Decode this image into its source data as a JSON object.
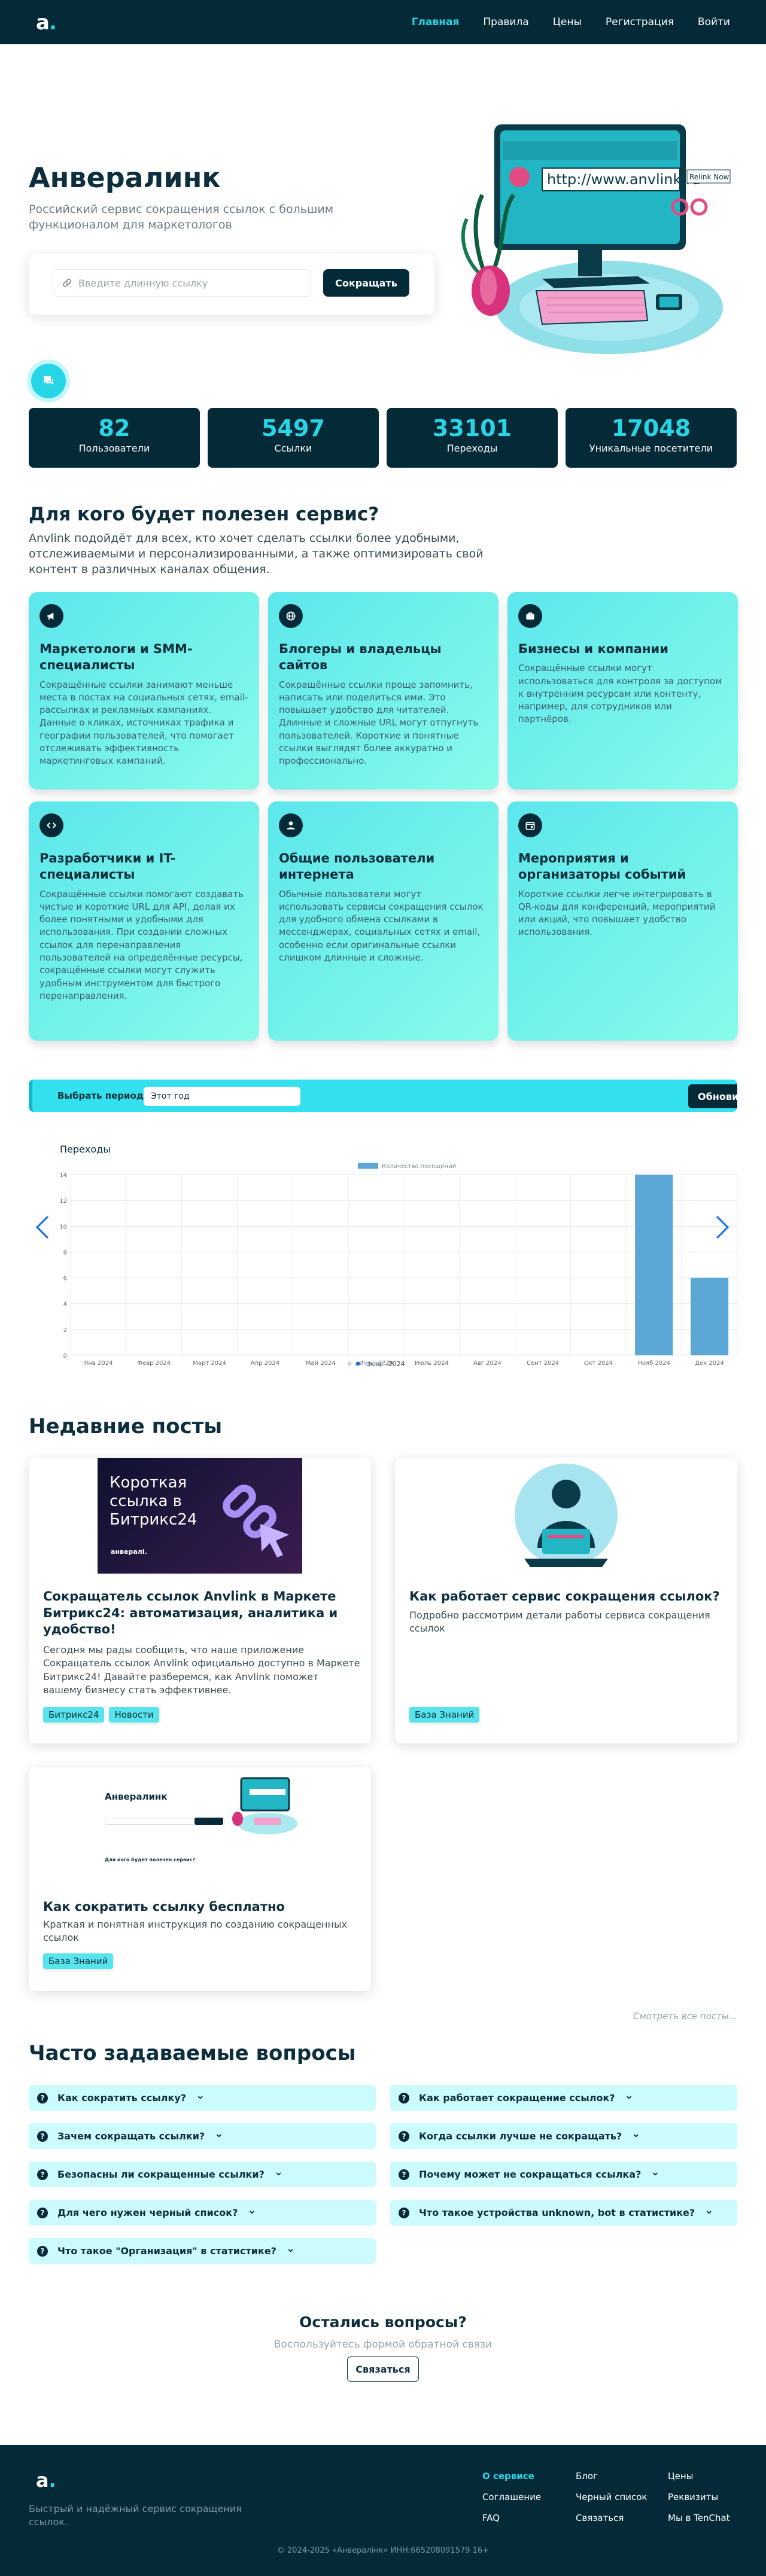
{
  "nav": {
    "logo": "a",
    "items": [
      "Главная",
      "Правила",
      "Цены",
      "Регистрация",
      "Войти"
    ]
  },
  "hero": {
    "title": "Анвералинк",
    "subtitle": "Российский сервис сокращения ссылок с большим функционалом для маркетологов",
    "input_placeholder": "Введите длинную ссылку",
    "button": "Сокращать",
    "illustration_url": "http://www.anvlink.ru",
    "illustration_tag": "Relink Now"
  },
  "stats": [
    {
      "value": "82",
      "label": "Пользователи"
    },
    {
      "value": "5497",
      "label": "Ссылки"
    },
    {
      "value": "33101",
      "label": "Переходы"
    },
    {
      "value": "17048",
      "label": "Уникальные посетители"
    }
  ],
  "audience": {
    "title": "Для кого будет полезен сервис?",
    "lead": "Anvlink подойдёт для всех, кто хочет сделать ссылки более удобными, отслеживаемыми и персонализированными, а также оптимизировать свой контент в различных каналах общения.",
    "cards": [
      {
        "icon": "megaphone-icon",
        "title": "Маркетологи и SMM-специалисты",
        "text": "Сокращённые ссылки занимают меньше места в постах на социальных сетях, email-рассылках и рекламных кампаниях. Данные о кликах, источниках трафика и географии пользователей, что помогает отслеживать эффективность маркетинговых кампаний."
      },
      {
        "icon": "globe-icon",
        "title": "Блогеры и владельцы сайтов",
        "text": "Сокращённые ссылки проще запомнить, написать или поделиться ими. Это повышает удобство для читателей. Длинные и сложные URL могут отпугнуть пользователей. Короткие и понятные ссылки выглядят более аккуратно и профессионально."
      },
      {
        "icon": "briefcase-icon",
        "title": "Бизнесы и компании",
        "text": "Сокращённые ссылки могут использоваться для контроля за доступом к внутренним ресурсам или контенту, например, для сотрудников или партнёров."
      },
      {
        "icon": "code-icon",
        "title": "Разработчики и IT-специалисты",
        "text": "Сокращённые ссылки помогают создавать чистые и короткие URL для API, делая их более понятными и удобными для использования. При создании сложных ссылок для перенаправления пользователей на определённые ресурсы, сокращённые ссылки могут служить удобным инструментом для быстрого перенаправления."
      },
      {
        "icon": "person-icon",
        "title": "Общие пользователи интернета",
        "text": "Обычные пользователи могут использовать сервисы сокращения ссылок для удобного обмена ссылками в мессенджерах, социальных сетях и email, особенно если оригинальные ссылки слишком длинные и сложные."
      },
      {
        "icon": "calendar-icon",
        "title": "Мероприятия и организаторы событий",
        "text": "Короткие ссылки легче интегрировать в QR-коды для конференций, мероприятий или акций, что повышает удобство использования."
      }
    ]
  },
  "period": {
    "label": "Выбрать период",
    "value": "Этот год",
    "button": "Обновит"
  },
  "chart_data": {
    "type": "bar",
    "title": "Переходы",
    "legend": [
      "Количество посещений"
    ],
    "legend_position": "top",
    "categories": [
      "Янв 2024",
      "Февр 2024",
      "Март 2024",
      "Апр 2024",
      "Май 2024",
      "Июнь 2024",
      "Июль 2024",
      "Авг 2024",
      "Сент 2024",
      "Окт 2024",
      "Нояб 2024",
      "Дек 2024"
    ],
    "category_overlay": "февр. 2024",
    "series": [
      {
        "name": "Количество посещений",
        "values": [
          0,
          0,
          0,
          0,
          0,
          0,
          0,
          0,
          0,
          0,
          14,
          6
        ]
      }
    ],
    "ylim": [
      0,
      14
    ],
    "yticks": [
      0,
      2,
      4,
      6,
      8,
      10,
      12,
      14
    ],
    "grid": true,
    "color": "#5aa6d4"
  },
  "carousel": {
    "dots": 5,
    "active": 1
  },
  "posts": {
    "title": "Недавние посты",
    "items": [
      {
        "title": "Сокращатель ссылок Anvlink в Маркете Битрикс24: автоматизация, аналитика и удобство!",
        "desc": "Сегодня мы рады сообщить, что наше приложение Сокращатель ссылок Anvlink официально доступно в Маркете Битрикс24! Давайте разберемся, как Anvlink поможет вашему бизнесу стать эффективнее.",
        "tags": [
          "Битрикс24",
          "Новости"
        ],
        "thumb_text": "Короткая ссылка в Битрикс24",
        "thumb_brand": "анвералі."
      },
      {
        "title": "Как работает сервис сокращения ссылок?",
        "desc": "Подробно рассмотрим детали работы сервиса сокращения ссылок",
        "tags": [
          "База Знаний"
        ]
      },
      {
        "title": "Как сократить ссылку бесплатно",
        "desc": "Краткая и понятная инструкция по созданию сокращенных ссылок",
        "tags": [
          "База Знаний"
        ],
        "thumb_title": "Анвералинк",
        "thumb_sub": "Для кого будет полезен сервис?"
      }
    ],
    "all": "Смотреть все посты..."
  },
  "faq": {
    "title": "Часто задаваемые вопросы",
    "left": [
      "Как сократить ссылку?",
      "Зачем сокращать ссылки?",
      "Безопасны ли сокращенные ссылки?",
      "Для чего нужен черный список?",
      "Что такое \"Организация\" в статистике?"
    ],
    "right": [
      "Как работает сокращение ссылок?",
      "Когда ссылки лучше не сокращать?",
      "Почему может не сокращаться ссылка?",
      "Что такое устройства unknown, bot в статистике?"
    ]
  },
  "questions": {
    "title": "Остались вопросы?",
    "sub": "Воспользуйтесь формой обратной связи",
    "button": "Связаться"
  },
  "footer": {
    "logo": "a",
    "tagline": "Быстрый и надёжный сервис сокращения ссылок.",
    "col1": [
      "О сервисе",
      "Соглашение",
      "FAQ"
    ],
    "col2": [
      "Блог",
      "Черный список",
      "Связаться"
    ],
    "col3": [
      "Цены",
      "Реквизиты",
      "Мы в TenChat"
    ],
    "copyright": "© 2024-2025 «Анвералінк» ИНН:665208091579 16+"
  }
}
